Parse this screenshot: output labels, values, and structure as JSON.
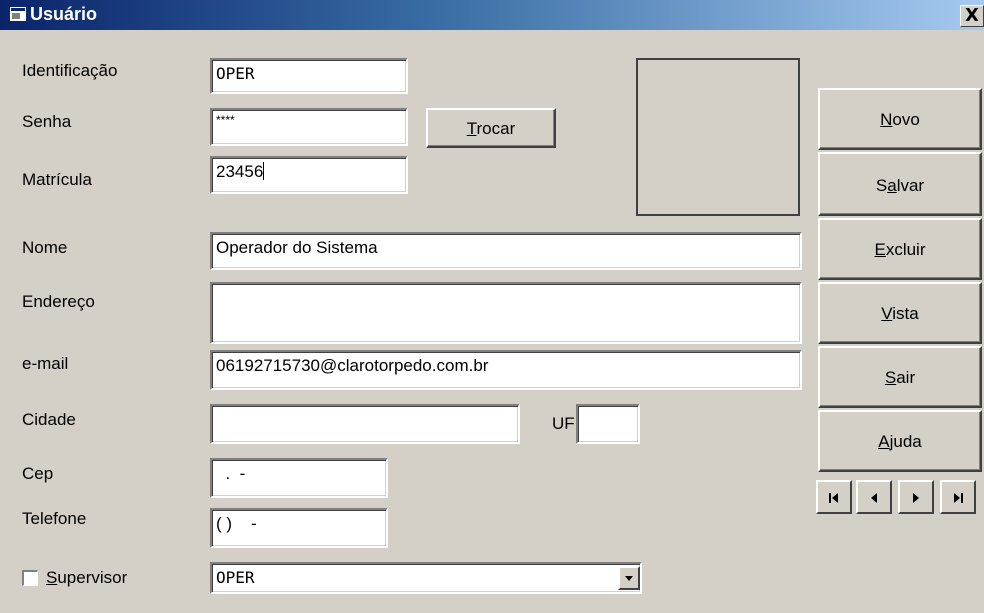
{
  "window": {
    "title": "Usuário",
    "close_label": "X"
  },
  "labels": {
    "identificacao": "Identificação",
    "senha": "Senha",
    "matricula": "Matrícula",
    "nome": "Nome",
    "endereco": "Endereço",
    "email": "e-mail",
    "cidade": "Cidade",
    "uf": "UF",
    "cep": "Cep",
    "telefone": "Telefone"
  },
  "fields": {
    "identificacao": "OPER",
    "senha": "****",
    "matricula": "23456",
    "nome": "Operador do Sistema",
    "endereco": "",
    "email": "06192715730@clarotorpedo.com.br",
    "cidade": "",
    "uf": "",
    "cep": "  .  -",
    "telefone": "( )    -"
  },
  "buttons": {
    "trocar": {
      "key": "T",
      "rest": "rocar"
    },
    "novo": {
      "key": "N",
      "rest": "ovo"
    },
    "salvar": {
      "pre": "S",
      "key": "a",
      "rest": "lvar"
    },
    "excluir": {
      "key": "E",
      "rest": "xcluir"
    },
    "vista": {
      "key": "V",
      "rest": "ista"
    },
    "sair": {
      "key": "S",
      "rest": "air"
    },
    "ajuda": {
      "key": "A",
      "rest": "juda"
    }
  },
  "supervisor": {
    "key": "S",
    "rest": "upervisor",
    "checked": false,
    "selected": "OPER"
  },
  "nav_icons": [
    "first-record-icon",
    "previous-record-icon",
    "next-record-icon",
    "last-record-icon"
  ]
}
